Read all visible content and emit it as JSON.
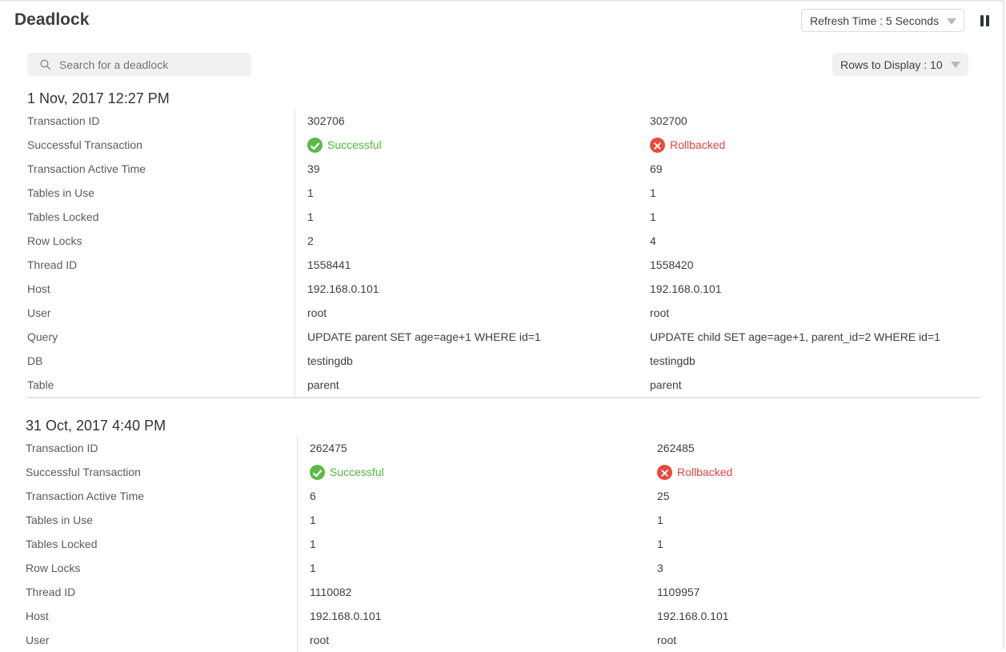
{
  "header": {
    "title": "Deadlock",
    "refresh_label": "Refresh Time : 5 Seconds",
    "pause_icon": "pause-icon"
  },
  "toolbar": {
    "search_placeholder": "Search for a deadlock",
    "rows_label": "Rows to Display : 10"
  },
  "colors": {
    "success": "#52b640",
    "rollback": "#e8453c"
  },
  "deadlocks": [
    {
      "date": "1 Nov, 2017 12:27 PM",
      "rows": [
        {
          "label": "Transaction ID",
          "a": "302706",
          "b": "302700"
        },
        {
          "label": "Successful Transaction",
          "a": "Successful",
          "b": "Rollbacked"
        },
        {
          "label": "Transaction Active Time",
          "a": "39",
          "b": "69"
        },
        {
          "label": "Tables in Use",
          "a": "1",
          "b": "1"
        },
        {
          "label": "Tables Locked",
          "a": "1",
          "b": "1"
        },
        {
          "label": "Row Locks",
          "a": "2",
          "b": "4"
        },
        {
          "label": "Thread ID",
          "a": "1558441",
          "b": "1558420"
        },
        {
          "label": "Host",
          "a": "192.168.0.101",
          "b": "192.168.0.101"
        },
        {
          "label": "User",
          "a": "root",
          "b": "root"
        },
        {
          "label": "Query",
          "a": "UPDATE parent SET age=age+1 WHERE id=1",
          "b": "UPDATE child SET age=age+1, parent_id=2 WHERE id=1"
        },
        {
          "label": "DB",
          "a": "testingdb",
          "b": "testingdb"
        },
        {
          "label": "Table",
          "a": "parent",
          "b": "parent"
        }
      ]
    },
    {
      "date": "31 Oct, 2017 4:40 PM",
      "rows": [
        {
          "label": "Transaction ID",
          "a": "262475",
          "b": "262485"
        },
        {
          "label": "Successful Transaction",
          "a": "Successful",
          "b": "Rollbacked"
        },
        {
          "label": "Transaction Active Time",
          "a": "6",
          "b": "25"
        },
        {
          "label": "Tables in Use",
          "a": "1",
          "b": "1"
        },
        {
          "label": "Tables Locked",
          "a": "1",
          "b": "1"
        },
        {
          "label": "Row Locks",
          "a": "1",
          "b": "3"
        },
        {
          "label": "Thread ID",
          "a": "1110082",
          "b": "1109957"
        },
        {
          "label": "Host",
          "a": "192.168.0.101",
          "b": "192.168.0.101"
        },
        {
          "label": "User",
          "a": "root",
          "b": "root"
        }
      ]
    }
  ]
}
